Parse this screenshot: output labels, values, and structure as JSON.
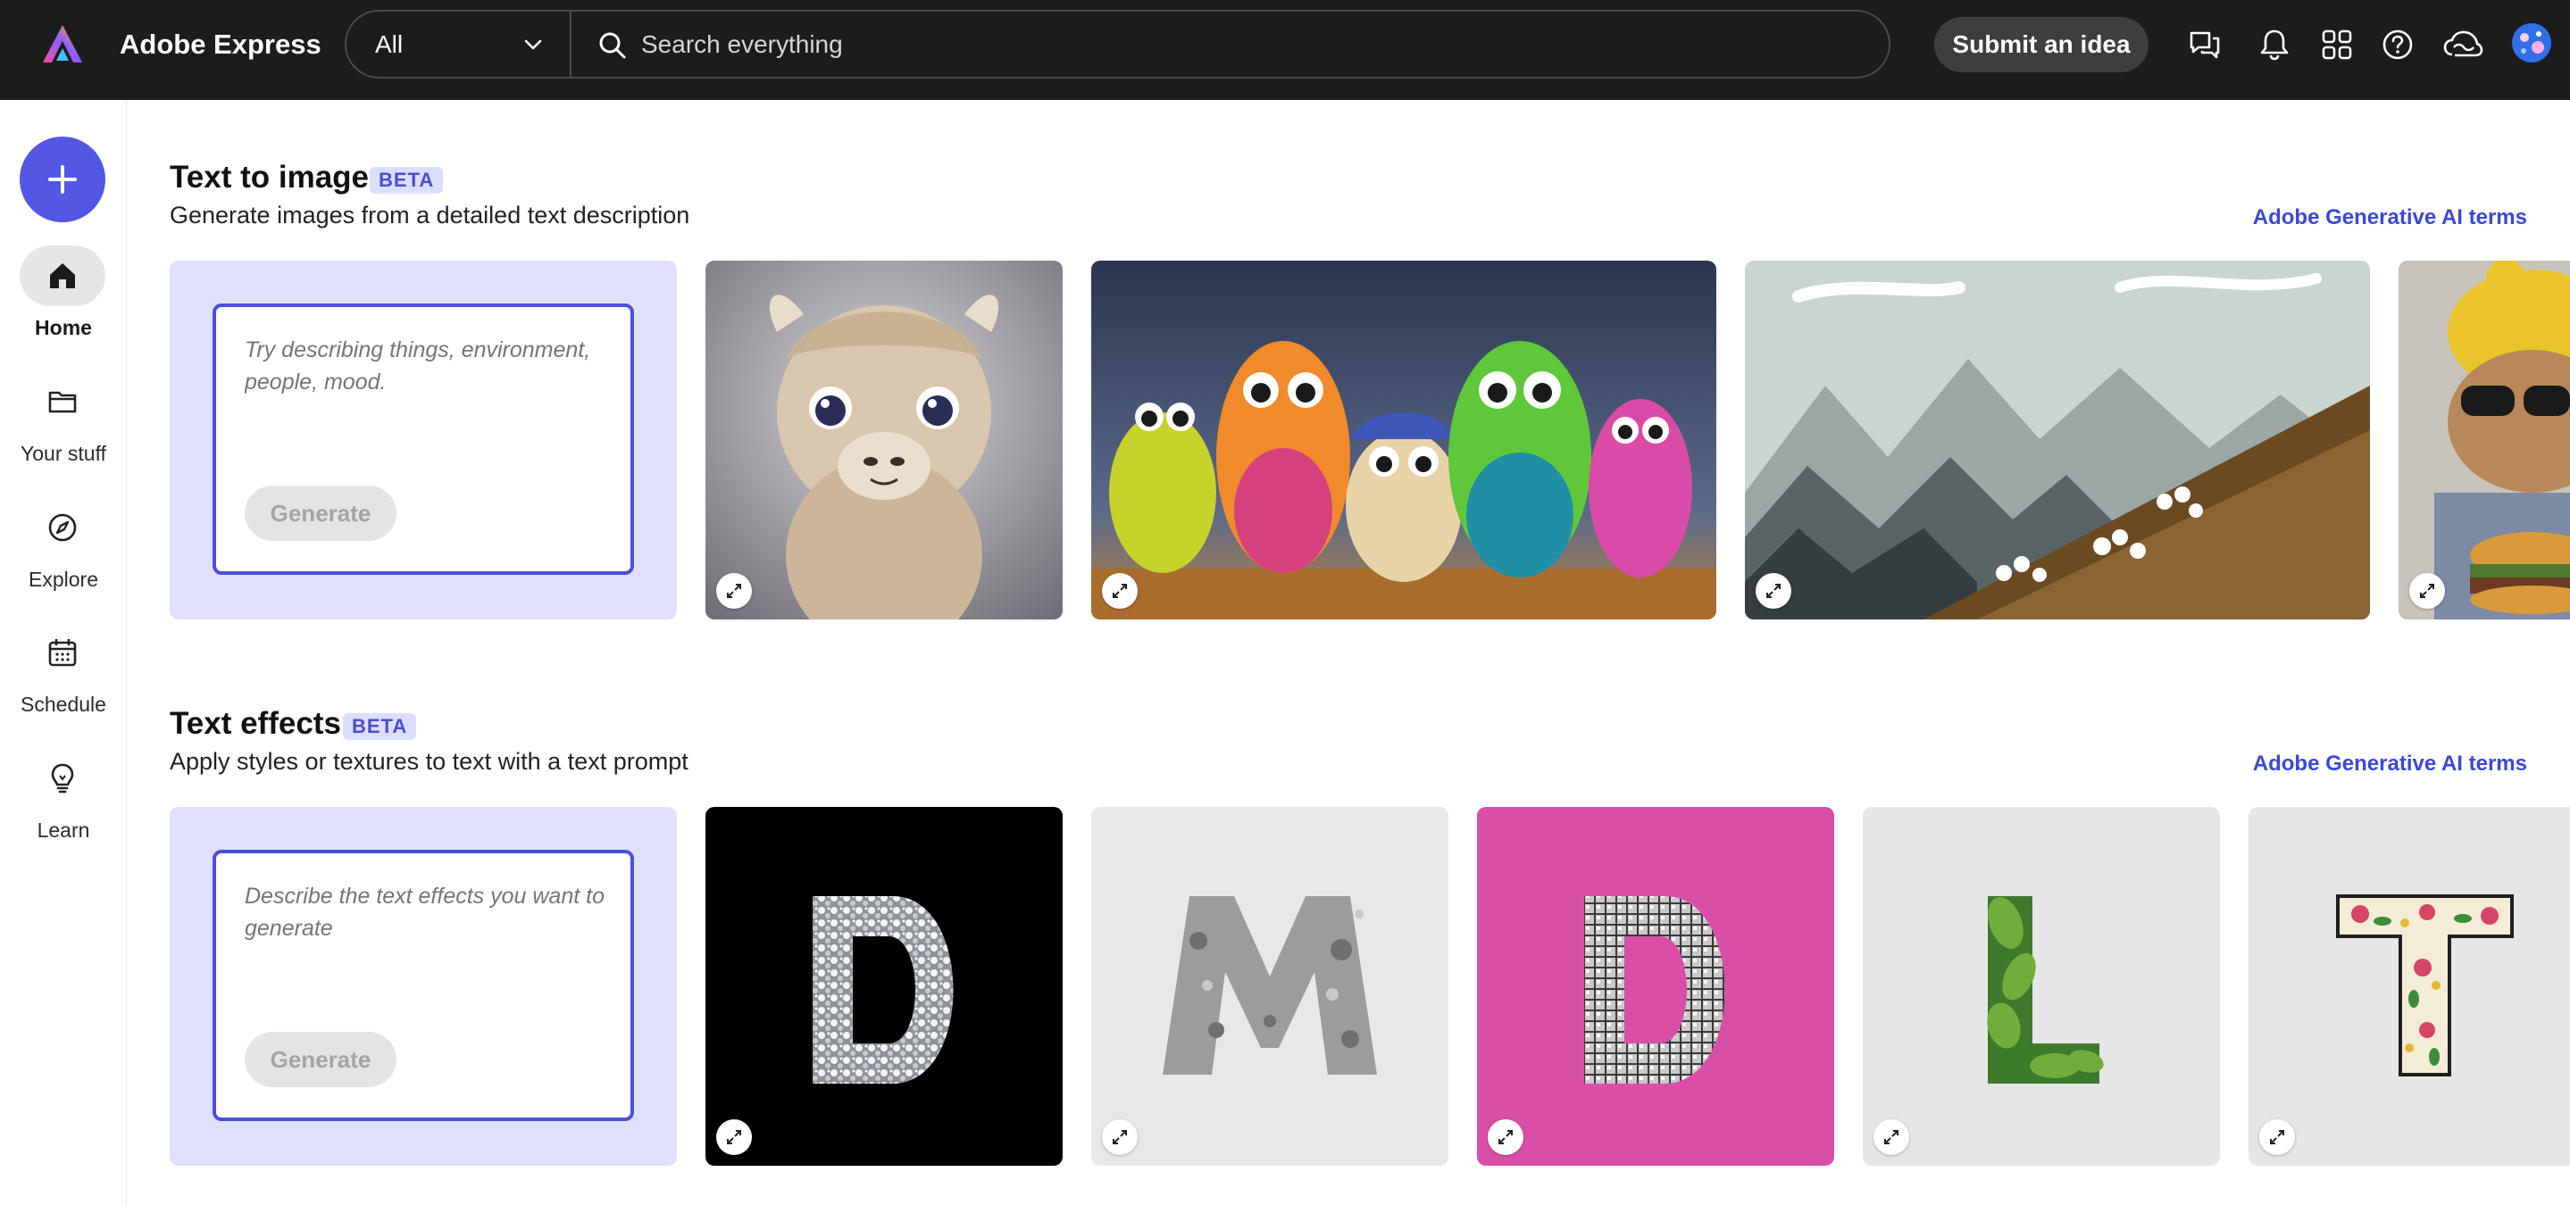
{
  "header": {
    "app_title": "Adobe Express",
    "search": {
      "scope_value": "All",
      "placeholder": "Search everything"
    },
    "submit_idea_label": "Submit an idea",
    "icons": [
      "chat-icon",
      "bell-icon",
      "apps-grid-icon",
      "help-icon",
      "creative-cloud-icon",
      "user-avatar"
    ]
  },
  "leftrail": {
    "create_icon": "plus-icon",
    "items": [
      {
        "label": "Home",
        "icon": "home-icon",
        "active": true
      },
      {
        "label": "Your stuff",
        "icon": "folder-icon",
        "active": false
      },
      {
        "label": "Explore",
        "icon": "compass-icon",
        "active": false
      },
      {
        "label": "Schedule",
        "icon": "calendar-icon",
        "active": false
      },
      {
        "label": "Learn",
        "icon": "lightbulb-icon",
        "active": false
      }
    ]
  },
  "text_to_image": {
    "title": "Text to image",
    "badge": "BETA",
    "subtitle": "Generate images from a detailed text description",
    "terms_link": "Adobe Generative AI terms",
    "prompt_placeholder": "Try describing things, environment, people, mood.",
    "generate_label": "Generate",
    "examples": [
      "llama-image",
      "owls-image",
      "mountains-image",
      "cat-burger-image"
    ]
  },
  "text_effects": {
    "title": "Text effects",
    "badge": "BETA",
    "subtitle": "Apply styles or textures to text with a text prompt",
    "terms_link": "Adobe Generative AI terms",
    "prompt_placeholder": "Describe the text effects you want to generate",
    "generate_label": "Generate",
    "examples": [
      {
        "letter": "D",
        "style": "diamond"
      },
      {
        "letter": "M",
        "style": "moon-rock"
      },
      {
        "letter": "D",
        "style": "disco-ball"
      },
      {
        "letter": "L",
        "style": "leaves"
      },
      {
        "letter": "T",
        "style": "embroidery"
      }
    ]
  },
  "colors": {
    "topbar": "#1c1c1c",
    "accent": "#5258e4",
    "link": "#3b48d6",
    "prompt_card": "#dfe1fb"
  }
}
